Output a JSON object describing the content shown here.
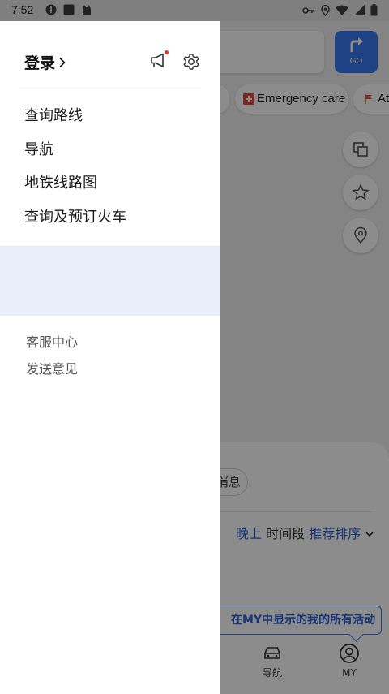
{
  "status_bar": {
    "time": "7:52"
  },
  "drawer": {
    "login_label": "登录",
    "menu": [
      {
        "label": "查询路线"
      },
      {
        "label": "导航"
      },
      {
        "label": "地铁线路图"
      },
      {
        "label": "查询及预订火车"
      }
    ],
    "footer_links": [
      {
        "label": "客服中心"
      },
      {
        "label": "发送意见"
      }
    ],
    "notification_dot_color": "#e8322e",
    "banner_color": "#e8eef9"
  },
  "background_app": {
    "go_button_label": "GO",
    "chips": [
      {
        "label": "Emergency care"
      },
      {
        "label": "At"
      }
    ],
    "news_chip_label": "消息",
    "sort_row": {
      "time_value": "晚上",
      "time_label": "时间段",
      "sort_value": "推荐排序"
    },
    "tooltip_text": "在MY中显示的我的所有活动",
    "bottom_tabs": [
      {
        "label": "导航"
      },
      {
        "label": "MY"
      }
    ],
    "accent_color": "#3a78f0"
  }
}
